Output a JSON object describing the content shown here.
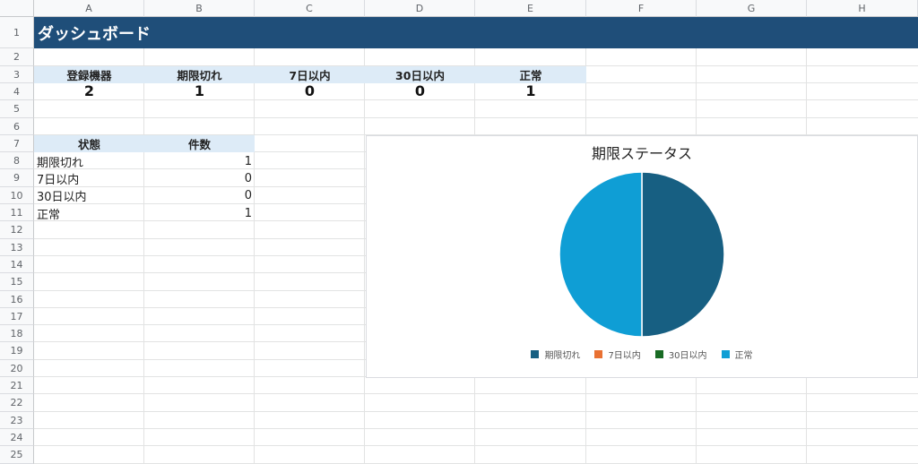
{
  "columns": [
    "A",
    "B",
    "C",
    "D",
    "E",
    "F",
    "G",
    "H"
  ],
  "rows": [
    "1",
    "2",
    "3",
    "4",
    "5",
    "6",
    "7",
    "8",
    "9",
    "10",
    "11",
    "12",
    "13",
    "14",
    "15",
    "16",
    "17",
    "18",
    "19",
    "20",
    "21",
    "22",
    "23",
    "24",
    "25"
  ],
  "banner": {
    "title": "ダッシュボード"
  },
  "kpis": [
    {
      "label": "登録機器",
      "value": "2"
    },
    {
      "label": "期限切れ",
      "value": "1"
    },
    {
      "label": "7日以内",
      "value": "0"
    },
    {
      "label": "30日以内",
      "value": "0"
    },
    {
      "label": "正常",
      "value": "1"
    }
  ],
  "status_table": {
    "headers": [
      "状態",
      "件数"
    ],
    "rows": [
      {
        "status": "期限切れ",
        "count": "1"
      },
      {
        "status": "7日以内",
        "count": "0"
      },
      {
        "status": "30日以内",
        "count": "0"
      },
      {
        "status": "正常",
        "count": "1"
      }
    ]
  },
  "colors": {
    "banner": "#1f4e79",
    "header_fill": "#ddebf7",
    "expired": "#175f82",
    "within7": "#e97132",
    "within30": "#196b24",
    "normal": "#0f9ed5"
  },
  "chart_data": {
    "type": "pie",
    "title": "期限ステータス",
    "categories": [
      "期限切れ",
      "7日以内",
      "30日以内",
      "正常"
    ],
    "values": [
      1,
      0,
      0,
      1
    ],
    "colors": [
      "#175f82",
      "#e97132",
      "#196b24",
      "#0f9ed5"
    ],
    "legend": "bottom"
  }
}
